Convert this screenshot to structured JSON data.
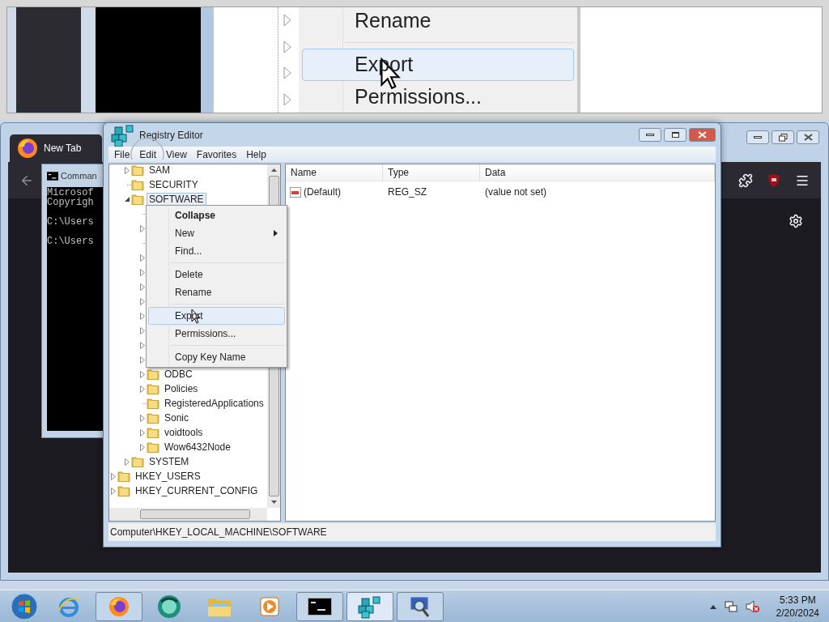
{
  "magnified_view": {
    "menu_items": [
      {
        "kind": "item",
        "label": "Rename",
        "selected": false
      },
      {
        "kind": "separator"
      },
      {
        "kind": "item",
        "label": "Export",
        "selected": true
      },
      {
        "kind": "item",
        "label": "Permissions...",
        "selected": false
      }
    ]
  },
  "browser": {
    "tab": "New Tab"
  },
  "console": {
    "title": "Comman",
    "paragraphs": [
      [
        "Microsof",
        "Copyrigh"
      ],
      [
        "C:\\Users"
      ],
      [
        "C:\\Users"
      ]
    ]
  },
  "registry_editor": {
    "title": "Registry Editor",
    "menu": [
      "File",
      "Edit",
      "View",
      "Favorites",
      "Help"
    ],
    "tree": [
      {
        "children": [
          {
            "label": "SAM",
            "expandable": true,
            "expanded": false,
            "selected": false
          },
          {
            "label": "SECURITY",
            "expandable": false,
            "selected": false
          },
          {
            "label": "SOFTWARE",
            "expandable": true,
            "expanded": true,
            "selected": true,
            "children": [
              {
                "expandable": false
              },
              {
                "expandable": true,
                "expanded": false
              },
              {
                "expandable": false
              },
              {
                "expandable": true,
                "expanded": false
              },
              {
                "expandable": true,
                "expanded": false
              },
              {
                "expandable": true,
                "expanded": false
              },
              {
                "expandable": true,
                "expanded": false
              },
              {
                "expandable": true,
                "expanded": false
              },
              {
                "expandable": true,
                "expanded": false
              },
              {
                "expandable": true,
                "expanded": false
              },
              {
                "expandable": true,
                "expanded": false
              },
              {
                "label": "ODBC",
                "expandable": true,
                "expanded": false,
                "selected": false
              },
              {
                "label": "Policies",
                "expandable": true,
                "expanded": false,
                "selected": false
              },
              {
                "label": "RegisteredApplications",
                "expandable": false,
                "selected": false
              },
              {
                "label": "Sonic",
                "expandable": true,
                "expanded": false,
                "selected": false
              },
              {
                "label": "voidtools",
                "expandable": true,
                "expanded": false,
                "selected": false
              },
              {
                "label": "Wow6432Node",
                "expandable": true,
                "expanded": false,
                "selected": false
              }
            ]
          },
          {
            "label": "SYSTEM",
            "expandable": true,
            "expanded": false,
            "selected": false
          }
        ]
      },
      {
        "label": "HKEY_USERS",
        "expandable": true,
        "expanded": false,
        "selected": false
      },
      {
        "label": "HKEY_CURRENT_CONFIG",
        "expandable": true,
        "expanded": false,
        "selected": false
      }
    ],
    "columns": [
      "Name",
      "Type",
      "Data"
    ],
    "rows": [
      {
        "name": "(Default)",
        "type": "REG_SZ",
        "data": "(value not set)"
      }
    ],
    "status_bar": "Computer\\HKEY_LOCAL_MACHINE\\SOFTWARE"
  },
  "context_menu": [
    {
      "kind": "item",
      "label": "Collapse",
      "default": true,
      "submenu": false,
      "selected": false
    },
    {
      "kind": "item",
      "label": "New",
      "default": false,
      "submenu": true,
      "selected": false
    },
    {
      "kind": "item",
      "label": "Find...",
      "default": false,
      "submenu": false,
      "selected": false
    },
    {
      "kind": "separator"
    },
    {
      "kind": "item",
      "label": "Delete",
      "default": false,
      "submenu": false,
      "selected": false
    },
    {
      "kind": "item",
      "label": "Rename",
      "default": false,
      "submenu": false,
      "selected": false
    },
    {
      "kind": "separator"
    },
    {
      "kind": "item",
      "label": "Export",
      "default": false,
      "submenu": false,
      "selected": true
    },
    {
      "kind": "item",
      "label": "Permissions...",
      "default": false,
      "submenu": false,
      "selected": false
    },
    {
      "kind": "separator"
    },
    {
      "kind": "item",
      "label": "Copy Key Name",
      "default": false,
      "submenu": false,
      "selected": false
    }
  ],
  "taskbar": {
    "items": [
      {
        "kind": "start",
        "open": false,
        "active": false
      },
      {
        "kind": "ie",
        "open": false,
        "active": false
      },
      {
        "kind": "firefox",
        "open": true,
        "active": false
      },
      {
        "kind": "disc",
        "open": false,
        "active": false
      },
      {
        "kind": "folder",
        "open": false,
        "active": false
      },
      {
        "kind": "media",
        "open": false,
        "active": false
      },
      {
        "kind": "console",
        "open": true,
        "active": false
      },
      {
        "kind": "registry",
        "open": true,
        "active": true
      },
      {
        "kind": "magnifier",
        "open": true,
        "active": false
      }
    ],
    "time": "5:33 PM",
    "date": "2/20/2024"
  }
}
